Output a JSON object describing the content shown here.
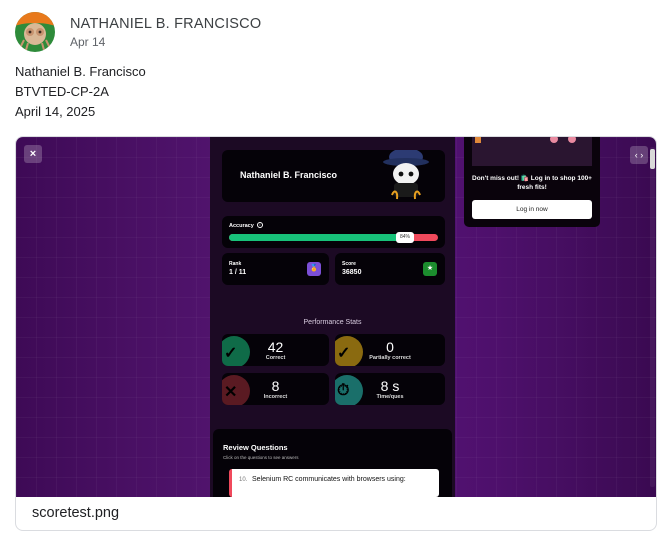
{
  "post": {
    "author": "NATHANIEL B. FRANCISCO",
    "date": "Apr 14",
    "body_lines": [
      "Nathaniel B. Francisco",
      "BTVTED-CP-2A",
      "April 14, 2025"
    ]
  },
  "attachment": {
    "filename": "scoretest.png"
  },
  "screenshot": {
    "close_label": "×",
    "code_label": "‹ ›",
    "player_name": "Nathaniel B. Francisco",
    "accuracy": {
      "label": "Accuracy",
      "info_icon": "info-icon",
      "percent_label": "84%",
      "fraction": 0.84
    },
    "rank": {
      "label": "Rank",
      "value": "1 / 11",
      "icon": "medal-icon"
    },
    "score": {
      "label": "Score",
      "value": "36850",
      "icon": "star-icon"
    },
    "performance_title": "Performance Stats",
    "stats": {
      "correct": {
        "value": "42",
        "label": "Correct"
      },
      "partial": {
        "value": "0",
        "label": "Partially correct"
      },
      "incorrect": {
        "value": "8",
        "label": "Incorrect"
      },
      "time": {
        "value": "8 s",
        "label": "Time/ques"
      }
    },
    "review": {
      "title": "Review Questions",
      "subtitle": "Click on the questions to see answers",
      "first_question": {
        "number": "10.",
        "text": "Selenium RC communicates with browsers using:"
      }
    },
    "ad": {
      "text": "Don't miss out! 🛍️ Log in to shop 100+ fresh fits!",
      "button": "Log in now"
    }
  },
  "colors": {
    "accent_green": "#18c27a",
    "accent_red": "#f0495c",
    "purple_bg": "#531570"
  }
}
